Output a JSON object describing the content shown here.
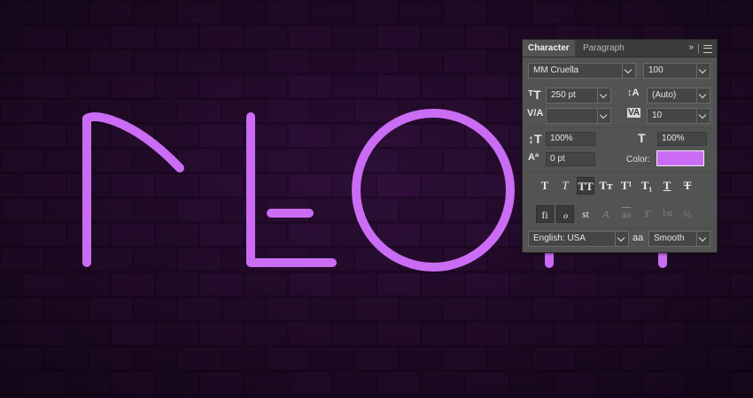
{
  "panel": {
    "tabs": [
      {
        "label": "Character",
        "active": true
      },
      {
        "label": "Paragraph",
        "active": false
      }
    ],
    "more_icon": "»",
    "font_family": "MM Cruella",
    "font_style": "100",
    "font_size": "250 pt",
    "leading": "(Auto)",
    "kerning": "",
    "tracking": "10",
    "vertical_scale": "100%",
    "horizontal_scale": "100%",
    "baseline_shift": "0 pt",
    "color_label": "Color:",
    "color_value": "#cb6cf5",
    "type_style_buttons": [
      {
        "name": "faux-bold",
        "glyph": "T",
        "active": false
      },
      {
        "name": "faux-italic",
        "glyph": "T",
        "active": false
      },
      {
        "name": "all-caps",
        "glyph": "TT",
        "active": true
      },
      {
        "name": "small-caps",
        "glyph": "Tт",
        "active": false
      },
      {
        "name": "superscript",
        "glyph": "T¹",
        "active": false
      },
      {
        "name": "subscript",
        "glyph": "T₁",
        "active": false
      },
      {
        "name": "underline",
        "glyph": "T",
        "active": false
      },
      {
        "name": "strikethrough",
        "glyph": "T",
        "active": false
      }
    ],
    "opentype_buttons": [
      {
        "name": "ligatures",
        "glyph": "fi",
        "active": true
      },
      {
        "name": "discretionary-ligatures",
        "glyph": "ℴ",
        "active": true
      },
      {
        "name": "stylistic-alternates",
        "glyph": "st",
        "active": false
      },
      {
        "name": "swash",
        "glyph": "A",
        "active": false
      },
      {
        "name": "titling-alternates",
        "glyph": "aa",
        "active": false
      },
      {
        "name": "ornaments",
        "glyph": "T",
        "active": false
      },
      {
        "name": "ordinals",
        "glyph": "1st",
        "active": false
      },
      {
        "name": "fractions",
        "glyph": "½",
        "active": false
      }
    ],
    "language": "English: USA",
    "antialias_icon": "aa",
    "antialias": "Smooth"
  },
  "canvas": {
    "text_color": "#cb6cf5",
    "wall_color": "#2a0d33"
  }
}
